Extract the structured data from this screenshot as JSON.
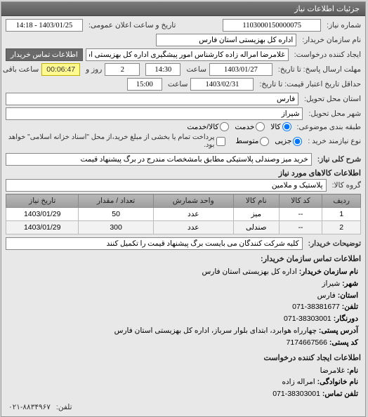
{
  "panel_title": "جزئیات اطلاعات نیاز",
  "labels": {
    "ref_no": "شماره نیاز:",
    "announce_dt": "تاریخ و ساعت اعلان عمومی:",
    "buyer_name": "نام سازمان خریدار:",
    "creator": "ایجاد کننده درخواست:",
    "contact_btn": "اطلاعات تماس خریدار",
    "resp_deadline": "مهلت ارسال پاسخ: تا تاریخ:",
    "time_lbl": "ساعت",
    "day_lbl": "روز و",
    "remain_lbl": "ساعت باقی مانده",
    "credit_valid": "حداقل تاریخ اعتبار قیمت: تا تاریخ:",
    "delivery_state": "استان محل تحویل:",
    "delivery_city": "شهر محل تحویل:",
    "pkg_topic": "طبقه بندی موضوعی:",
    "goods": "کالا",
    "service": "خدمت",
    "goods_service": "کالا/خدمت",
    "need_type": "نوع نیازمند خرید :",
    "small": "جزیی",
    "medium": "متوسط",
    "payment_note": "پرداخت تمام یا بخشی از مبلغ خرید،از محل \"اسناد خزانه اسلامی\" خواهد بود.",
    "summary_lbl": "شرح کلی نیاز:",
    "goods_info_title": "اطلاعات کالاهای مورد نیاز",
    "goods_group": "گروه کالا:",
    "buyer_notes": "توضیحات خریدار:",
    "contact_title": "اطلاعات تماس سازمان خریدار:",
    "org_name_lbl": "نام سازمان خریدار:",
    "city_lbl": "شهر:",
    "state_lbl": "استان:",
    "phone_lbl": "تلفن:",
    "fax_lbl": "دورنگار:",
    "postal_lbl": "آدرس پستی:",
    "postcode_lbl": "کد پستی:",
    "creator_info_title": "اطلاعات ایجاد کننده درخواست",
    "name_lbl": "نام:",
    "family_lbl": "نام خانوادگی:",
    "contact_phone_lbl": "تلفن تماس:",
    "footer_phone_lbl": "تلفن:"
  },
  "values": {
    "ref_no": "1103000150000075",
    "announce_dt": "1403/01/25 - 14:18",
    "buyer_name": "اداره کل بهزیستی استان فارس",
    "creator": "غلامرضا امراله زاده کارشناس امور پیشگیری اداره کل بهزیستی استان فارس",
    "resp_date": "1403/01/27",
    "resp_time": "14:30",
    "remain_days": "2",
    "remain_time": "00:06:47",
    "credit_date": "1403/02/31",
    "credit_time": "15:00",
    "delivery_state": "فارس",
    "delivery_city": "شیراز",
    "summary": "خرید میز وصندلی پلاستیکی مطابق بامشخصات مندرج در برگ پیشنهاد قیمت",
    "goods_group": "پلاستیک و ملامین",
    "buyer_notes": "کلیه شرکت کنندگان می بایست برگ پیشنهاد قیمت را تکمیل کنند",
    "org_name": "اداره کل بهزیستی استان فارس",
    "city": "شیراز",
    "state": "فارس",
    "phone": "38381677-071",
    "fax": "38303001-071",
    "postal": "چهارراه هوابرد، ابتدای بلوار سرباز، اداره کل بهزیستی استان فارس",
    "postcode": "7174667566",
    "creator_name": "غلامرضا",
    "creator_family": "امراله زاده",
    "creator_phone": "38303001-071",
    "footer_phone": "۰۲۱-۸۸۳۴۹۶۷"
  },
  "table": {
    "headers": [
      "ردیف",
      "کد کالا",
      "نام کالا",
      "واحد شمارش",
      "تعداد / مقدار",
      "تاریخ نیاز"
    ],
    "rows": [
      [
        "1",
        "--",
        "میز",
        "عدد",
        "50",
        "1403/01/29"
      ],
      [
        "2",
        "--",
        "صندلی",
        "عدد",
        "300",
        "1403/01/29"
      ]
    ]
  }
}
